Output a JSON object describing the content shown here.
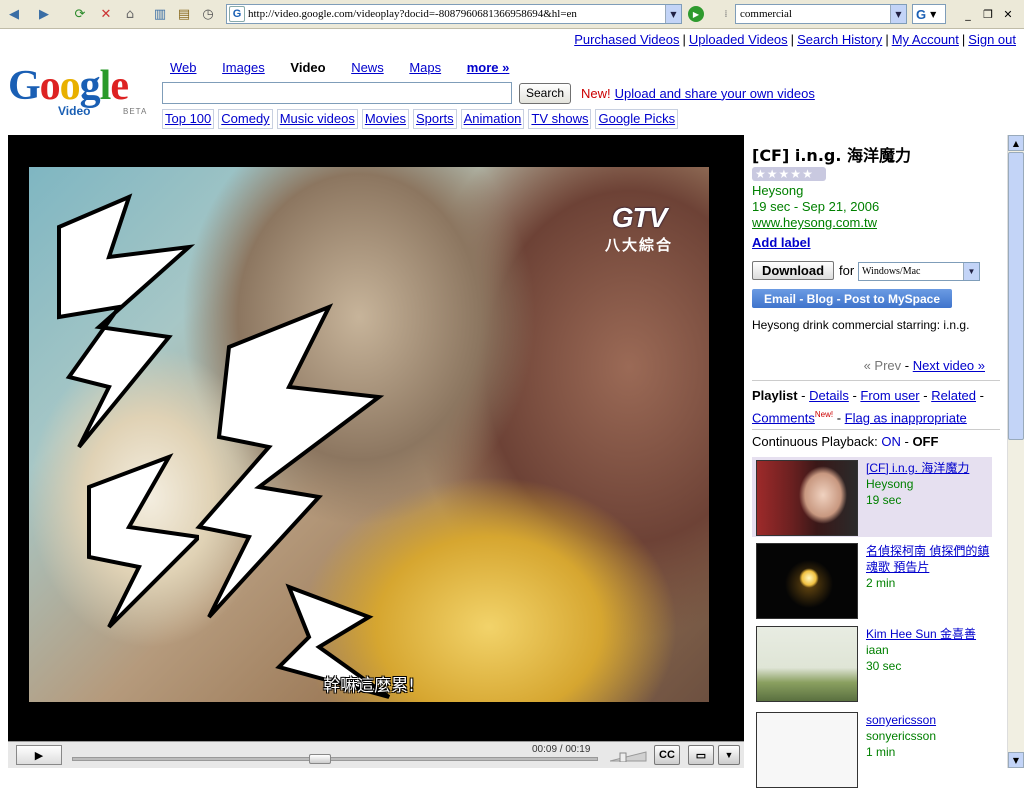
{
  "browser": {
    "address": "http://video.google.com/videoplay?docid=-8087960681366958694&hl=en",
    "search_query": "commercial",
    "search_engine_glyph": "G"
  },
  "top_links": [
    "Purchased Videos",
    "Uploaded Videos",
    "Search History",
    "My Account",
    "Sign out"
  ],
  "logo": {
    "word": [
      "G",
      "o",
      "o",
      "g",
      "l",
      "e"
    ],
    "sub": "Video",
    "beta": "BETA"
  },
  "nav_tabs": [
    {
      "label": "Web"
    },
    {
      "label": "Images"
    },
    {
      "label": "Video"
    },
    {
      "label": "News"
    },
    {
      "label": "Maps"
    },
    {
      "label": "more »"
    }
  ],
  "search": {
    "button": "Search",
    "new_label": "New!",
    "upload_link": "Upload and share your own videos"
  },
  "categories": [
    "Top 100",
    "Comedy",
    "Music videos",
    "Movies",
    "Sports",
    "Animation",
    "TV shows",
    "Google Picks"
  ],
  "player": {
    "channel_logo": "GTV",
    "channel_sub": "八大綜合",
    "subtitle": "幹嘛這麼累!",
    "time": "00:09 / 00:19",
    "progress": 0.47,
    "cc_label": "CC"
  },
  "video": {
    "title": "[CF] i.n.g. 海洋魔力",
    "author": "Heysong",
    "meta": "19 sec - Sep 21, 2006",
    "site": "www.heysong.com.tw",
    "add_label": "Add label",
    "download": "Download",
    "for": "for",
    "os_option": "Windows/Mac",
    "share": "Email - Blog - Post to MySpace",
    "description": "Heysong drink commercial starring: i.n.g.",
    "prev": "« Prev",
    "prev_sep": " - ",
    "next": "Next video »"
  },
  "playlist_links": {
    "label": "Playlist",
    "details": "Details",
    "from_user": "From user",
    "related": "Related",
    "comments": "Comments",
    "comments_badge": "New!",
    "flag": "Flag as inappropriate"
  },
  "continuous": {
    "label": "Continuous Playback:",
    "on": "ON",
    "sep": " - ",
    "off": "OFF"
  },
  "playlist": [
    {
      "title": "[CF] i.n.g. 海洋魔力",
      "author": "Heysong",
      "duration": "19 sec"
    },
    {
      "title": "名偵探柯南 偵探們的鎮魂歌 預告片",
      "author": "",
      "duration": "2 min"
    },
    {
      "title": "Kim Hee Sun 金喜善",
      "author": "iaan",
      "duration": "30 sec"
    },
    {
      "title": "sonyericsson",
      "author": "sonyericsson",
      "duration": "1 min"
    }
  ],
  "colors": {
    "link": "#0000cc",
    "green": "#008000",
    "new_red": "#cc0000"
  }
}
